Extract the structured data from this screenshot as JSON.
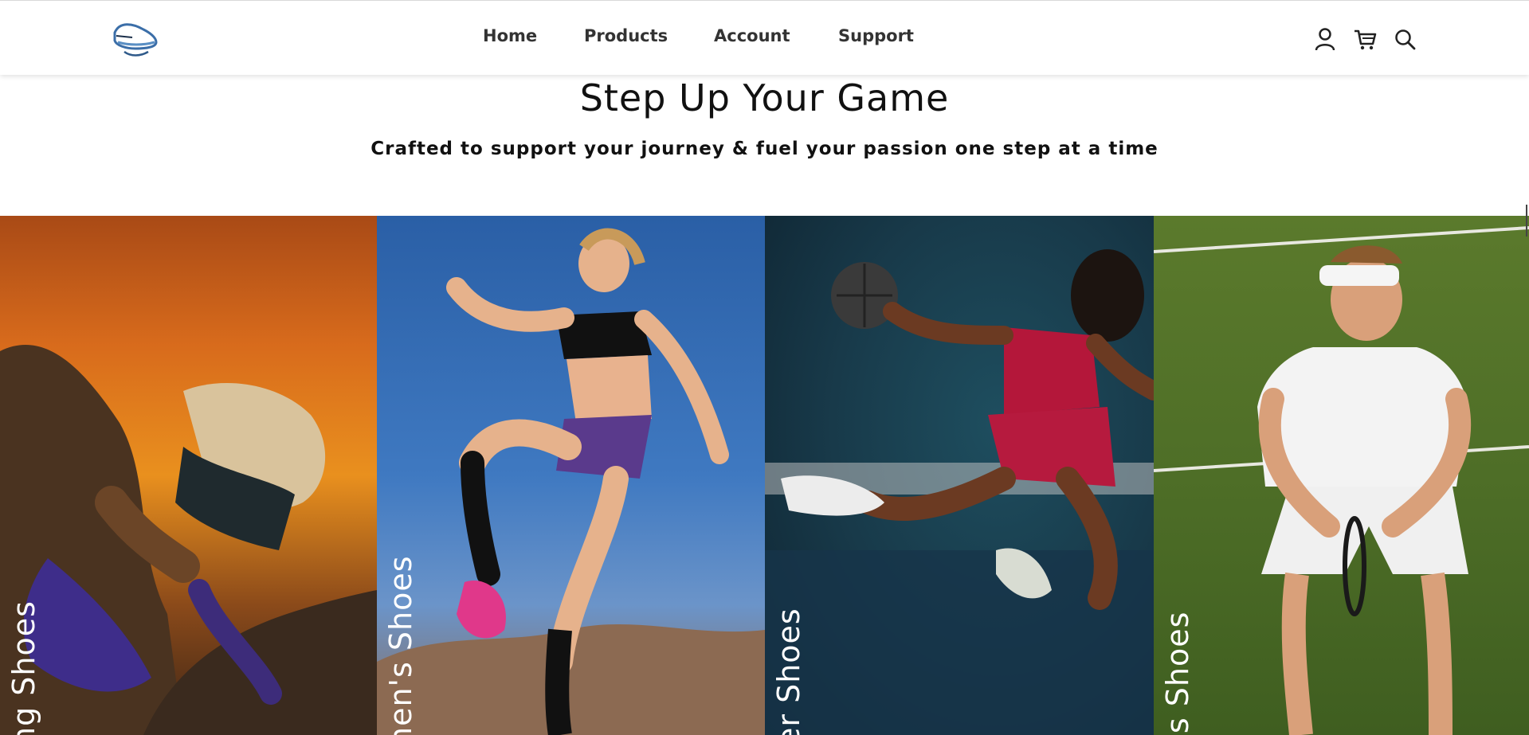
{
  "header": {
    "logo_icon": "shoe-logo-icon",
    "nav": [
      "Home",
      "Products",
      "Account",
      "Support"
    ],
    "icons": [
      "user-icon",
      "cart-icon",
      "search-icon"
    ]
  },
  "hero": {
    "title": "Step Up Your Game",
    "subtitle": "Crafted to support your journey & fuel your passion one step at a time"
  },
  "categories": [
    {
      "label": "ng Shoes",
      "theme": "hiking"
    },
    {
      "label": "nen's Shoes",
      "theme": "fitness"
    },
    {
      "label": "er Shoes",
      "theme": "basketball"
    },
    {
      "label": "ts Shoes",
      "theme": "tennis"
    }
  ],
  "colors": {
    "text": "#111111",
    "nav_text": "#333333",
    "logo_blue": "#3b6ea8"
  }
}
